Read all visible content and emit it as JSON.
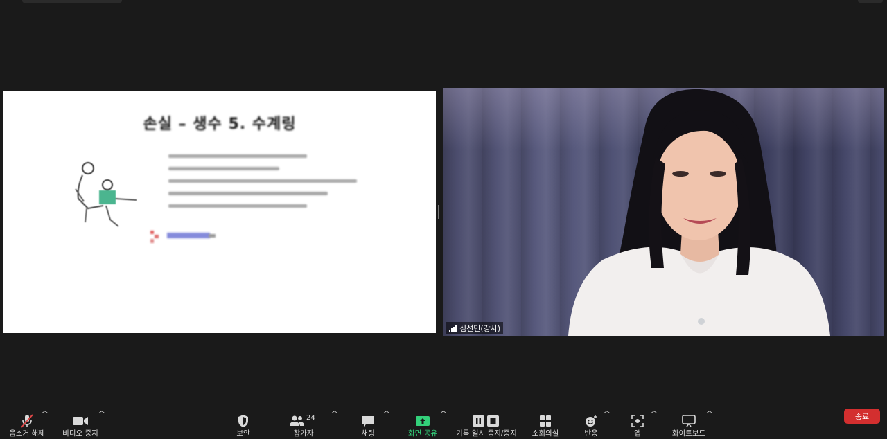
{
  "participant": {
    "name": "심선민(강사)"
  },
  "shared_slide": {
    "title": "손실 – 생수 5. 수계링"
  },
  "toolbar": {
    "mute_label": "음소거 해제",
    "video_label": "비디오 중지",
    "security_label": "보안",
    "participants_label": "참가자",
    "participants_count": "24",
    "chat_label": "채팅",
    "share_label": "화면 공유",
    "record_label": "기록 일시 중지/중지",
    "breakout_label": "소회의실",
    "reactions_label": "반응",
    "apps_label": "앱",
    "whiteboard_label": "화이트보드",
    "end_label": "종료"
  },
  "colors": {
    "background": "#1a1a1a",
    "accent_green": "#33d17a",
    "end_red": "#d32f2f",
    "muted_red": "#e04848"
  },
  "icons": {
    "mute": "microphone-slash-icon",
    "video": "video-camera-icon",
    "security": "shield-icon",
    "participants": "people-icon",
    "chat": "chat-bubble-icon",
    "share": "share-screen-icon",
    "record": "pause-stop-icon",
    "breakout": "grid-icon",
    "reactions": "emoji-icon",
    "apps": "apps-icon",
    "whiteboard": "whiteboard-icon"
  }
}
